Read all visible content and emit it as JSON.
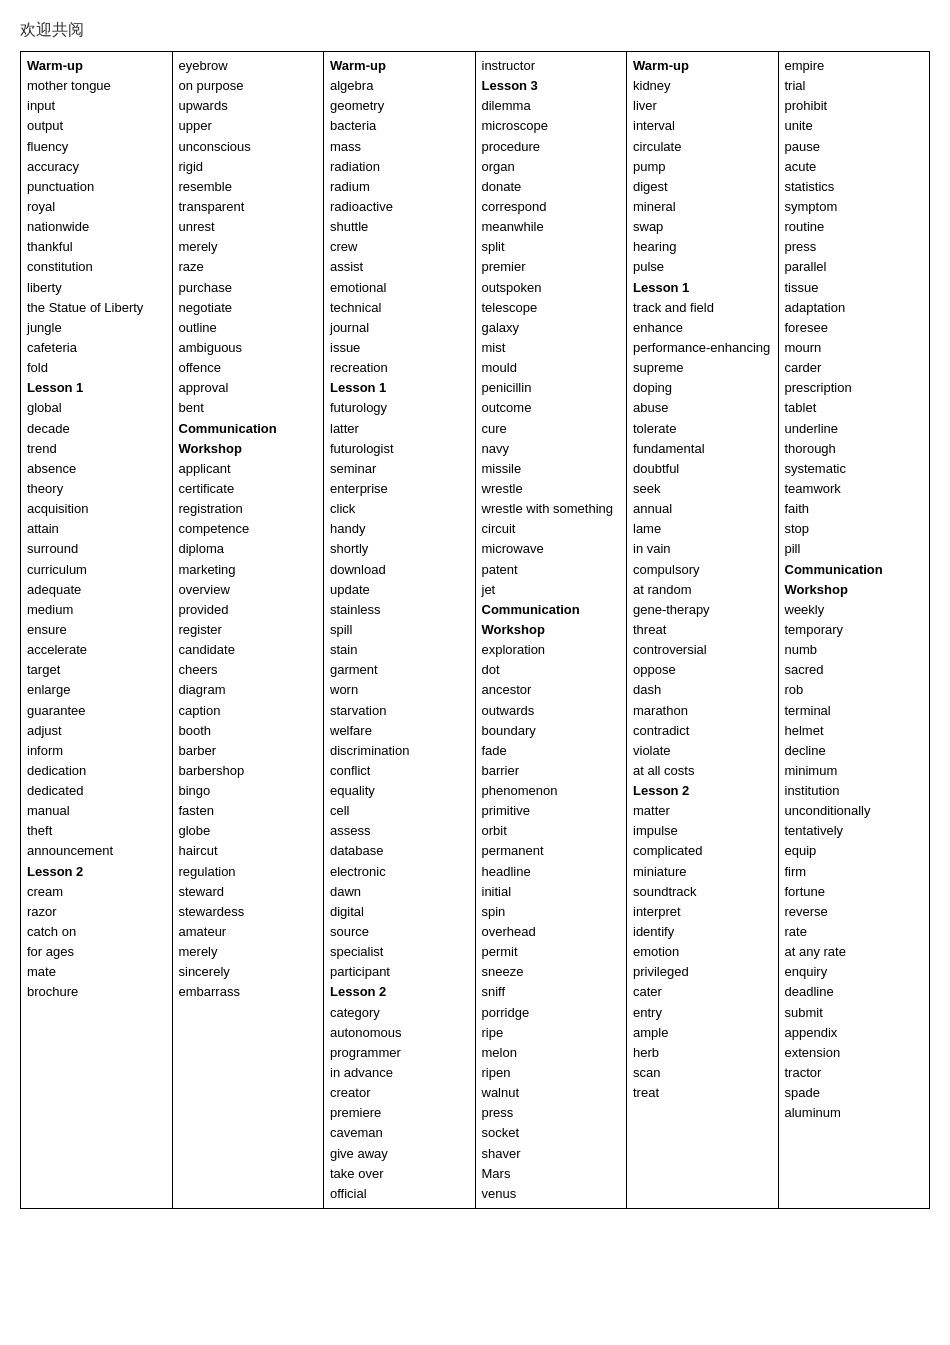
{
  "title": "欢迎共阅",
  "columns": [
    {
      "words": [
        {
          "text": "Warm-up",
          "bold": true
        },
        {
          "text": "mother tongue"
        },
        {
          "text": "input"
        },
        {
          "text": "output"
        },
        {
          "text": "fluency"
        },
        {
          "text": "accuracy"
        },
        {
          "text": "punctuation"
        },
        {
          "text": "royal"
        },
        {
          "text": "nationwide"
        },
        {
          "text": "thankful"
        },
        {
          "text": "constitution"
        },
        {
          "text": "liberty"
        },
        {
          "text": "the Statue of Liberty"
        },
        {
          "text": "jungle"
        },
        {
          "text": "cafeteria"
        },
        {
          "text": "fold"
        },
        {
          "text": "Lesson 1",
          "bold": true
        },
        {
          "text": "global"
        },
        {
          "text": "decade"
        },
        {
          "text": "trend"
        },
        {
          "text": "absence"
        },
        {
          "text": "theory"
        },
        {
          "text": "acquisition"
        },
        {
          "text": "attain"
        },
        {
          "text": "surround"
        },
        {
          "text": "curriculum"
        },
        {
          "text": "adequate"
        },
        {
          "text": "medium"
        },
        {
          "text": "ensure"
        },
        {
          "text": "accelerate"
        },
        {
          "text": "target"
        },
        {
          "text": "enlarge"
        },
        {
          "text": "guarantee"
        },
        {
          "text": "adjust"
        },
        {
          "text": "inform"
        },
        {
          "text": "dedication"
        },
        {
          "text": "dedicated"
        },
        {
          "text": "manual"
        },
        {
          "text": "theft"
        },
        {
          "text": "announcement"
        },
        {
          "text": "Lesson 2",
          "bold": true
        },
        {
          "text": "cream"
        },
        {
          "text": "razor"
        },
        {
          "text": "catch on"
        },
        {
          "text": "for ages"
        },
        {
          "text": "mate"
        },
        {
          "text": "brochure"
        }
      ]
    },
    {
      "words": [
        {
          "text": "eyebrow"
        },
        {
          "text": "on purpose"
        },
        {
          "text": "upwards"
        },
        {
          "text": "upper"
        },
        {
          "text": "unconscious"
        },
        {
          "text": "rigid"
        },
        {
          "text": "resemble"
        },
        {
          "text": "transparent"
        },
        {
          "text": "unrest"
        },
        {
          "text": "merely"
        },
        {
          "text": "raze"
        },
        {
          "text": "purchase"
        },
        {
          "text": "negotiate"
        },
        {
          "text": "outline"
        },
        {
          "text": "ambiguous"
        },
        {
          "text": "offence"
        },
        {
          "text": "approval"
        },
        {
          "text": "bent"
        },
        {
          "text": "Communication",
          "bold": true
        },
        {
          "text": "Workshop",
          "bold": true
        },
        {
          "text": "applicant"
        },
        {
          "text": "certificate"
        },
        {
          "text": "registration"
        },
        {
          "text": "competence"
        },
        {
          "text": "diploma"
        },
        {
          "text": "marketing"
        },
        {
          "text": "overview"
        },
        {
          "text": "provided"
        },
        {
          "text": "register"
        },
        {
          "text": "candidate"
        },
        {
          "text": "cheers"
        },
        {
          "text": "diagram"
        },
        {
          "text": "caption"
        },
        {
          "text": "booth"
        },
        {
          "text": "barber"
        },
        {
          "text": "barbershop"
        },
        {
          "text": "bingo"
        },
        {
          "text": "fasten"
        },
        {
          "text": "globe"
        },
        {
          "text": "haircut"
        },
        {
          "text": "regulation"
        },
        {
          "text": "steward"
        },
        {
          "text": "stewardess"
        },
        {
          "text": "amateur"
        },
        {
          "text": "merely"
        },
        {
          "text": "sincerely"
        },
        {
          "text": "embarrass"
        }
      ]
    },
    {
      "words": [
        {
          "text": "Warm-up",
          "bold": true
        },
        {
          "text": "algebra"
        },
        {
          "text": "geometry"
        },
        {
          "text": "bacteria"
        },
        {
          "text": "mass"
        },
        {
          "text": "radiation"
        },
        {
          "text": "radium"
        },
        {
          "text": "radioactive"
        },
        {
          "text": "shuttle"
        },
        {
          "text": "crew"
        },
        {
          "text": "assist"
        },
        {
          "text": "emotional"
        },
        {
          "text": "technical"
        },
        {
          "text": "journal"
        },
        {
          "text": "issue"
        },
        {
          "text": "recreation"
        },
        {
          "text": "Lesson 1",
          "bold": true
        },
        {
          "text": "futurology"
        },
        {
          "text": "latter"
        },
        {
          "text": "futurologist"
        },
        {
          "text": "seminar"
        },
        {
          "text": "enterprise"
        },
        {
          "text": "click"
        },
        {
          "text": "handy"
        },
        {
          "text": "shortly"
        },
        {
          "text": "download"
        },
        {
          "text": "update"
        },
        {
          "text": "stainless"
        },
        {
          "text": "spill"
        },
        {
          "text": "stain"
        },
        {
          "text": "garment"
        },
        {
          "text": "worn"
        },
        {
          "text": "starvation"
        },
        {
          "text": "welfare"
        },
        {
          "text": "discrimination"
        },
        {
          "text": "conflict"
        },
        {
          "text": "equality"
        },
        {
          "text": "cell"
        },
        {
          "text": "assess"
        },
        {
          "text": "database"
        },
        {
          "text": "electronic"
        },
        {
          "text": "dawn"
        },
        {
          "text": "digital"
        },
        {
          "text": "source"
        },
        {
          "text": "specialist"
        },
        {
          "text": "participant"
        },
        {
          "text": "Lesson 2",
          "bold": true
        },
        {
          "text": "category"
        },
        {
          "text": "autonomous"
        },
        {
          "text": "programmer"
        },
        {
          "text": "in advance"
        },
        {
          "text": "creator"
        },
        {
          "text": "premiere"
        },
        {
          "text": "caveman"
        },
        {
          "text": "give away"
        },
        {
          "text": "take over"
        },
        {
          "text": "official"
        }
      ]
    },
    {
      "words": [
        {
          "text": "instructor"
        },
        {
          "text": "Lesson 3",
          "bold": true
        },
        {
          "text": "dilemma"
        },
        {
          "text": "microscope"
        },
        {
          "text": "procedure"
        },
        {
          "text": "organ"
        },
        {
          "text": "donate"
        },
        {
          "text": "correspond"
        },
        {
          "text": "meanwhile"
        },
        {
          "text": "split"
        },
        {
          "text": "premier"
        },
        {
          "text": "outspoken"
        },
        {
          "text": "telescope"
        },
        {
          "text": "galaxy"
        },
        {
          "text": "mist"
        },
        {
          "text": "mould"
        },
        {
          "text": "penicillin"
        },
        {
          "text": "outcome"
        },
        {
          "text": "cure"
        },
        {
          "text": "navy"
        },
        {
          "text": "missile"
        },
        {
          "text": "wrestle"
        },
        {
          "text": "wrestle with something"
        },
        {
          "text": "circuit"
        },
        {
          "text": "microwave"
        },
        {
          "text": "patent"
        },
        {
          "text": "jet"
        },
        {
          "text": "Communication",
          "bold": true
        },
        {
          "text": "Workshop",
          "bold": true
        },
        {
          "text": "exploration"
        },
        {
          "text": "dot"
        },
        {
          "text": "ancestor"
        },
        {
          "text": "outwards"
        },
        {
          "text": "boundary"
        },
        {
          "text": "fade"
        },
        {
          "text": "barrier"
        },
        {
          "text": "phenomenon"
        },
        {
          "text": "primitive"
        },
        {
          "text": "orbit"
        },
        {
          "text": "permanent"
        },
        {
          "text": "headline"
        },
        {
          "text": "initial"
        },
        {
          "text": "spin"
        },
        {
          "text": "overhead"
        },
        {
          "text": "permit"
        },
        {
          "text": "sneeze"
        },
        {
          "text": "sniff"
        },
        {
          "text": "porridge"
        },
        {
          "text": "ripe"
        },
        {
          "text": "melon"
        },
        {
          "text": "ripen"
        },
        {
          "text": "walnut"
        },
        {
          "text": "press"
        },
        {
          "text": "socket"
        },
        {
          "text": "shaver"
        },
        {
          "text": "Mars"
        },
        {
          "text": "venus"
        }
      ]
    },
    {
      "words": [
        {
          "text": "Warm-up",
          "bold": true
        },
        {
          "text": "kidney"
        },
        {
          "text": "liver"
        },
        {
          "text": "interval"
        },
        {
          "text": "circulate"
        },
        {
          "text": "pump"
        },
        {
          "text": "digest"
        },
        {
          "text": "mineral"
        },
        {
          "text": "swap"
        },
        {
          "text": "hearing"
        },
        {
          "text": "pulse"
        },
        {
          "text": "Lesson 1",
          "bold": true
        },
        {
          "text": "track and field"
        },
        {
          "text": "enhance"
        },
        {
          "text": "performance-enhancing"
        },
        {
          "text": "supreme"
        },
        {
          "text": "doping"
        },
        {
          "text": "abuse"
        },
        {
          "text": "tolerate"
        },
        {
          "text": "fundamental"
        },
        {
          "text": "doubtful"
        },
        {
          "text": "seek"
        },
        {
          "text": "annual"
        },
        {
          "text": "lame"
        },
        {
          "text": "in vain"
        },
        {
          "text": "compulsory"
        },
        {
          "text": "at random"
        },
        {
          "text": "gene-therapy"
        },
        {
          "text": "threat"
        },
        {
          "text": "controversial"
        },
        {
          "text": "oppose"
        },
        {
          "text": "dash"
        },
        {
          "text": "marathon"
        },
        {
          "text": "contradict"
        },
        {
          "text": "violate"
        },
        {
          "text": "at all costs"
        },
        {
          "text": "Lesson 2",
          "bold": true
        },
        {
          "text": "matter"
        },
        {
          "text": "impulse"
        },
        {
          "text": "complicated"
        },
        {
          "text": "miniature"
        },
        {
          "text": "soundtrack"
        },
        {
          "text": "interpret"
        },
        {
          "text": "identify"
        },
        {
          "text": "emotion"
        },
        {
          "text": "privileged"
        },
        {
          "text": "cater"
        },
        {
          "text": "entry"
        },
        {
          "text": "ample"
        },
        {
          "text": "herb"
        },
        {
          "text": "scan"
        },
        {
          "text": "treat"
        }
      ]
    },
    {
      "words": [
        {
          "text": "empire"
        },
        {
          "text": "trial"
        },
        {
          "text": "prohibit"
        },
        {
          "text": "unite"
        },
        {
          "text": "pause"
        },
        {
          "text": "acute"
        },
        {
          "text": "statistics"
        },
        {
          "text": "symptom"
        },
        {
          "text": "routine"
        },
        {
          "text": "press"
        },
        {
          "text": "parallel"
        },
        {
          "text": "tissue"
        },
        {
          "text": "adaptation"
        },
        {
          "text": "foresee"
        },
        {
          "text": "mourn"
        },
        {
          "text": "carder"
        },
        {
          "text": "prescription"
        },
        {
          "text": "tablet"
        },
        {
          "text": "underline"
        },
        {
          "text": "thorough"
        },
        {
          "text": "systematic"
        },
        {
          "text": "teamwork"
        },
        {
          "text": "faith"
        },
        {
          "text": "stop"
        },
        {
          "text": "pill"
        },
        {
          "text": "Communication",
          "bold": true
        },
        {
          "text": "Workshop",
          "bold": true
        },
        {
          "text": "weekly"
        },
        {
          "text": "temporary"
        },
        {
          "text": "numb"
        },
        {
          "text": "sacred"
        },
        {
          "text": "rob"
        },
        {
          "text": "terminal"
        },
        {
          "text": "helmet"
        },
        {
          "text": "decline"
        },
        {
          "text": "minimum"
        },
        {
          "text": "institution"
        },
        {
          "text": "unconditionally"
        },
        {
          "text": "tentatively"
        },
        {
          "text": "equip"
        },
        {
          "text": "firm"
        },
        {
          "text": "fortune"
        },
        {
          "text": "reverse"
        },
        {
          "text": "rate"
        },
        {
          "text": "at any rate"
        },
        {
          "text": "enquiry"
        },
        {
          "text": "deadline"
        },
        {
          "text": "submit"
        },
        {
          "text": "appendix"
        },
        {
          "text": "extension"
        },
        {
          "text": "tractor"
        },
        {
          "text": "spade"
        },
        {
          "text": "aluminum"
        }
      ]
    }
  ]
}
